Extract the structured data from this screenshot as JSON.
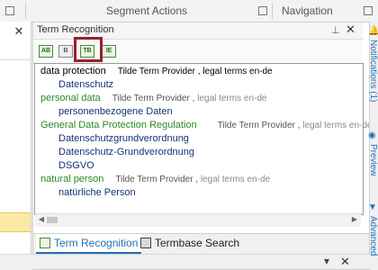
{
  "ribbon": {
    "groups": [
      {
        "label": "Segment Actions"
      },
      {
        "label": "Navigation"
      }
    ]
  },
  "pane": {
    "title": "Term Recognition",
    "pin_icon": "pin-icon",
    "close_icon": "close-icon"
  },
  "toolbar": {
    "buttons": [
      {
        "icon": "term-view-icon",
        "label": "AB"
      },
      {
        "icon": "term-detail-icon",
        "label": "B"
      },
      {
        "icon": "term-settings-icon",
        "label": "TB"
      },
      {
        "icon": "term-list-icon",
        "label": "IE"
      }
    ]
  },
  "results": [
    {
      "source": "data protection",
      "provider": "Tilde Term Provider ,",
      "termbase": "legal terms en-de",
      "style": "black",
      "targets": [
        "Datenschutz"
      ]
    },
    {
      "source": "personal data",
      "provider": "Tilde Term Provider ,",
      "termbase": "legal terms en-de",
      "style": "green",
      "targets": [
        "personenbezogene Daten"
      ]
    },
    {
      "source": "General Data Protection Regulation",
      "provider": "Tilde Term Provider ,",
      "termbase": "legal terms en-de",
      "style": "green",
      "targets": [
        "Datenschutzgrundverordnung",
        "Datenschutz-Grundverordnung",
        "DSGVO"
      ]
    },
    {
      "source": "natural person",
      "provider": "Tilde Term Provider ,",
      "termbase": "legal terms en-de",
      "style": "green",
      "targets": [
        "natürliche Person"
      ]
    }
  ],
  "tabs": [
    {
      "label": "Term Recognition",
      "active": true
    },
    {
      "label": "Termbase Search",
      "active": false
    }
  ],
  "right_panel": {
    "tabs": [
      {
        "label": "Notifications (1)",
        "icon": "bell-icon"
      },
      {
        "label": "Preview",
        "icon": "eye-icon"
      },
      {
        "label": "Advanced",
        "icon": "filter-icon"
      }
    ]
  },
  "colors": {
    "accent": "#1f6fb8",
    "source_green": "#2a8a2a",
    "target_blue": "#12337a",
    "highlight_box": "#9c1e2b",
    "selected_row": "#fde9a6"
  }
}
